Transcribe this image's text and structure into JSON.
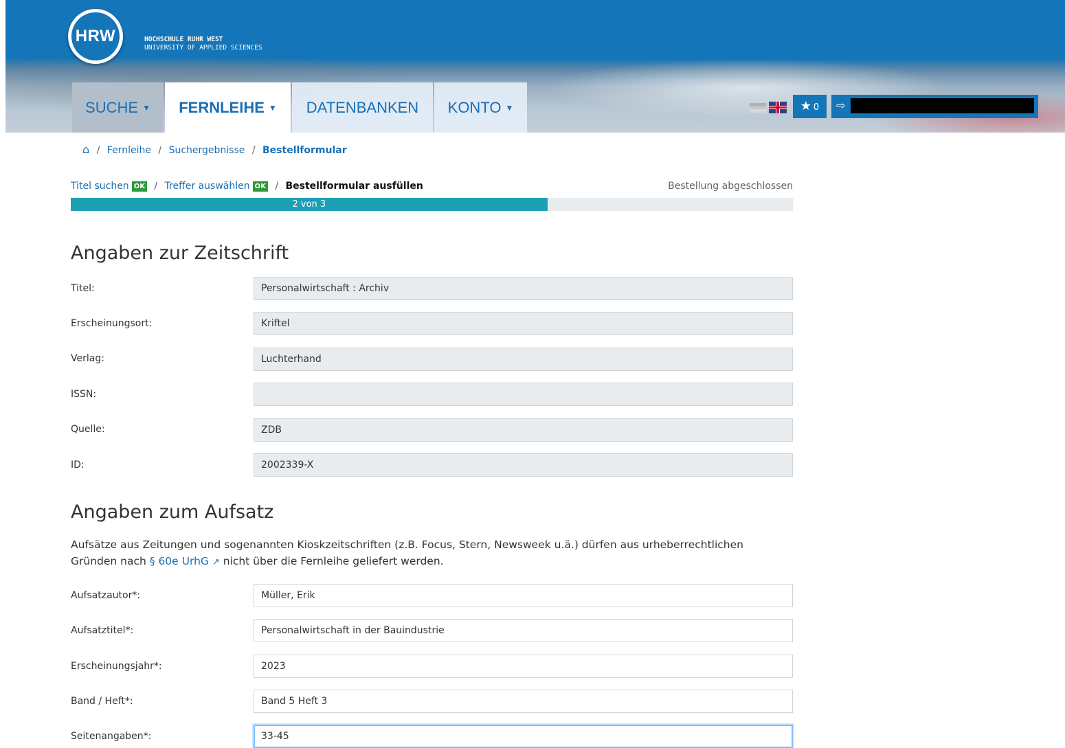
{
  "header": {
    "logo_text": "HRW",
    "university_line1": "HOCHSCHULE RUHR WEST",
    "university_line2": "UNIVERSITY OF APPLIED SCIENCES",
    "favorites_count": "0"
  },
  "nav": {
    "items": [
      {
        "label": "SUCHE",
        "dropdown": true
      },
      {
        "label": "FERNLEIHE",
        "dropdown": true,
        "active": true
      },
      {
        "label": "DATENBANKEN",
        "dropdown": false
      },
      {
        "label": "KONTO",
        "dropdown": true
      }
    ]
  },
  "breadcrumb": {
    "items": [
      "Fernleihe",
      "Suchergebnisse"
    ],
    "current": "Bestellformular"
  },
  "steps": {
    "step1": "Titel suchen",
    "step2": "Treffer auswählen",
    "ok": "OK",
    "step3": "Bestellformular ausfüllen",
    "final": "Bestellung abgeschlossen",
    "progress_label": "2 von 3",
    "progress_fraction": 0.66
  },
  "journal": {
    "heading": "Angaben zur Zeitschrift",
    "fields": [
      {
        "label": "Titel:",
        "value": "Personalwirtschaft : Archiv"
      },
      {
        "label": "Erscheinungsort:",
        "value": "Kriftel"
      },
      {
        "label": "Verlag:",
        "value": "Luchterhand"
      },
      {
        "label": "ISSN:",
        "value": ""
      },
      {
        "label": "Quelle:",
        "value": "ZDB"
      },
      {
        "label": "ID:",
        "value": "2002339-X"
      }
    ]
  },
  "article": {
    "heading": "Angaben zum Aufsatz",
    "info_text_1": "Aufsätze aus Zeitungen und sogenannten Kioskzeitschriften (z.B. Focus, Stern, Newsweek u.ä.) dürfen aus urheberrechtlichen Gründen nach ",
    "info_link": "§ 60e UrhG",
    "info_text_2": " nicht über die Fernleihe geliefert werden.",
    "fields": [
      {
        "label": "Aufsatzautor*:",
        "value": "Müller, Erik"
      },
      {
        "label": "Aufsatztitel*:",
        "value": "Personalwirtschaft in der Bauindustrie"
      },
      {
        "label": "Erscheinungsjahr*:",
        "value": "2023"
      },
      {
        "label": "Band / Heft*:",
        "value": "Band 5 Heft 3"
      },
      {
        "label": "Seitenangaben*:",
        "value": "33-45"
      }
    ]
  },
  "colors": {
    "brand_blue": "#1475b8",
    "link_blue": "#1a6fb4",
    "progress_teal": "#1ba0b6",
    "ok_green": "#2b9a3a"
  }
}
